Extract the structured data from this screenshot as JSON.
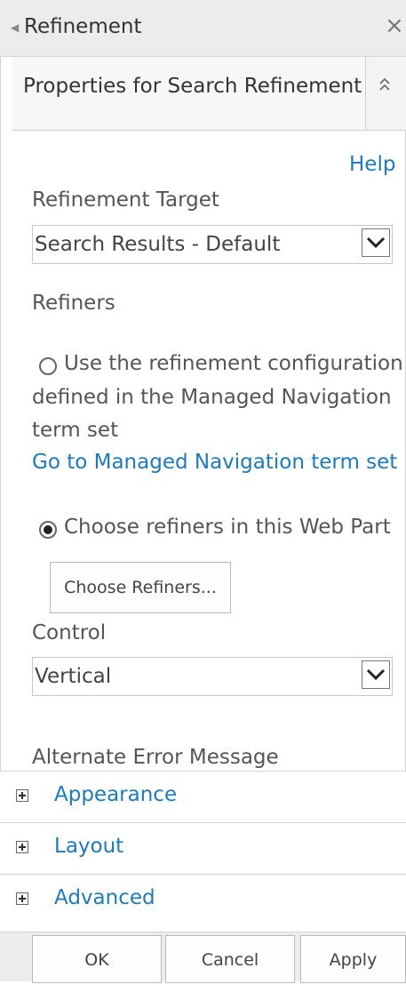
{
  "panel": {
    "title": "Refinement",
    "close_glyph": "×",
    "collapse_arrow_glyph": "◄"
  },
  "section": {
    "title": "Properties for Search Refinement",
    "collapse_glyph": "≈"
  },
  "help_link": "Help",
  "refinement_target": {
    "label": "Refinement Target",
    "selected": "Search Results - Default"
  },
  "refiners": {
    "label": "Refiners",
    "option_managed_line1": "Use the refinement configuration",
    "option_managed_line2": "defined in the Managed Navigation",
    "option_managed_line3": "term set",
    "managed_link": "Go to Managed Navigation term set",
    "option_webpart": "Choose refiners in this Web Part",
    "choose_button": "Choose Refiners..."
  },
  "control": {
    "label": "Control",
    "selected": "Vertical"
  },
  "alternate_error": {
    "label": "Alternate Error Message",
    "value": ""
  },
  "expanders": [
    {
      "label": "Appearance"
    },
    {
      "label": "Layout"
    },
    {
      "label": "Advanced"
    }
  ],
  "footer": {
    "ok": "OK",
    "cancel": "Cancel",
    "apply": "Apply"
  },
  "colors": {
    "link": "#1e7ab8",
    "header_bg": "#ececec"
  }
}
